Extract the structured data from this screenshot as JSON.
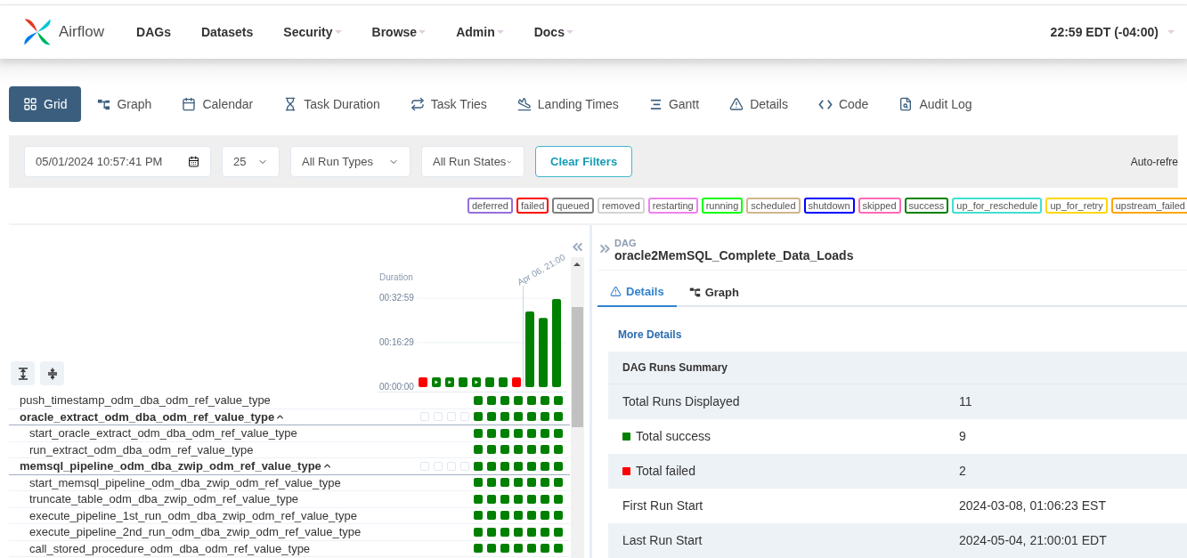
{
  "navbar": {
    "brand": "Airflow",
    "items": [
      {
        "label": "DAGs",
        "dropdown": false
      },
      {
        "label": "Datasets",
        "dropdown": false
      },
      {
        "label": "Security",
        "dropdown": true
      },
      {
        "label": "Browse",
        "dropdown": true
      },
      {
        "label": "Admin",
        "dropdown": true
      },
      {
        "label": "Docs",
        "dropdown": true
      }
    ],
    "clock": "22:59 EDT (-04:00)"
  },
  "view_tabs": [
    {
      "label": "Grid",
      "selected": true
    },
    {
      "label": "Graph",
      "selected": false
    },
    {
      "label": "Calendar",
      "selected": false
    },
    {
      "label": "Task Duration",
      "selected": false
    },
    {
      "label": "Task Tries",
      "selected": false
    },
    {
      "label": "Landing Times",
      "selected": false
    },
    {
      "label": "Gantt",
      "selected": false
    },
    {
      "label": "Details",
      "selected": false
    },
    {
      "label": "Code",
      "selected": false
    },
    {
      "label": "Audit Log",
      "selected": false
    }
  ],
  "filters": {
    "base_date": "05/01/2024 10:57:41 PM",
    "num_runs": "25",
    "run_type": "All Run Types",
    "run_state": "All Run States",
    "clear_button": "Clear Filters",
    "auto_refresh": "Auto-refre"
  },
  "legend": [
    {
      "label": "deferred",
      "color": "#9370db"
    },
    {
      "label": "failed",
      "color": "#ff0000"
    },
    {
      "label": "queued",
      "color": "#808080"
    },
    {
      "label": "removed",
      "color": "#d3d3d3"
    },
    {
      "label": "restarting",
      "color": "#ee82ee"
    },
    {
      "label": "running",
      "color": "#00ff00"
    },
    {
      "label": "scheduled",
      "color": "#d2b48c"
    },
    {
      "label": "shutdown",
      "color": "#0000ff"
    },
    {
      "label": "skipped",
      "color": "#ff69b4"
    },
    {
      "label": "success",
      "color": "#008000"
    },
    {
      "label": "up_for_reschedule",
      "color": "#40e0d0"
    },
    {
      "label": "up_for_retry",
      "color": "#ffd700"
    },
    {
      "label": "upstream_failed",
      "color": "#ffa500"
    }
  ],
  "grid": {
    "chart_data": {
      "type": "bar",
      "title": "Duration",
      "series": [
        {
          "values": [
            220,
            220,
            220,
            220,
            220,
            220,
            220,
            220,
            1680,
            1540,
            1960
          ]
        }
      ],
      "ylim": [
        0,
        1979
      ],
      "yticks": [
        {
          "value": 0,
          "label": "00:00:00"
        },
        {
          "value": 989,
          "label": "00:16:29"
        },
        {
          "value": 1979,
          "label": "00:32:59"
        }
      ],
      "annotations": [
        "Apr 06, 21:00"
      ]
    },
    "runs": [
      {
        "manual": false,
        "color": "#ff0000"
      },
      {
        "manual": true,
        "color": "#008000"
      },
      {
        "manual": true,
        "color": "#008000"
      },
      {
        "manual": false,
        "color": "#008000"
      },
      {
        "manual": true,
        "color": "#008000"
      },
      {
        "manual": false,
        "color": "#008000"
      },
      {
        "manual": false,
        "color": "#008000"
      },
      {
        "manual": false,
        "color": "#ff0000"
      },
      {
        "manual": false,
        "color": "#008000"
      },
      {
        "manual": false,
        "color": "#008000"
      },
      {
        "manual": false,
        "color": "#008000"
      }
    ],
    "tasks": [
      {
        "name": "push_timestamp_odm_dba_odm_ref_value_type",
        "instances": [
          {
            "kind": "none"
          },
          {
            "kind": "none"
          },
          {
            "kind": "none"
          },
          {
            "kind": "none"
          },
          {
            "kind": "success"
          },
          {
            "kind": "success"
          },
          {
            "kind": "success"
          },
          {
            "kind": "success"
          },
          {
            "kind": "success"
          },
          {
            "kind": "success"
          },
          {
            "kind": "success"
          }
        ]
      },
      {
        "name": "oracle_extract_odm_dba_odm_ref_value_type",
        "expanded": true,
        "instances": [
          {
            "kind": "empty"
          },
          {
            "kind": "empty"
          },
          {
            "kind": "empty"
          },
          {
            "kind": "empty"
          },
          {
            "kind": "success"
          },
          {
            "kind": "success"
          },
          {
            "kind": "success"
          },
          {
            "kind": "success"
          },
          {
            "kind": "success"
          },
          {
            "kind": "success"
          },
          {
            "kind": "success"
          }
        ],
        "children": [
          {
            "name": "start_oracle_extract_odm_dba_odm_ref_value_type",
            "instances": [
              {
                "kind": "none"
              },
              {
                "kind": "none"
              },
              {
                "kind": "none"
              },
              {
                "kind": "none"
              },
              {
                "kind": "success"
              },
              {
                "kind": "success"
              },
              {
                "kind": "success"
              },
              {
                "kind": "success"
              },
              {
                "kind": "success"
              },
              {
                "kind": "success"
              },
              {
                "kind": "success"
              }
            ]
          },
          {
            "name": "run_extract_odm_dba_odm_ref_value_type",
            "instances": [
              {
                "kind": "none"
              },
              {
                "kind": "none"
              },
              {
                "kind": "none"
              },
              {
                "kind": "none"
              },
              {
                "kind": "success"
              },
              {
                "kind": "success"
              },
              {
                "kind": "success"
              },
              {
                "kind": "success"
              },
              {
                "kind": "success"
              },
              {
                "kind": "success"
              },
              {
                "kind": "success"
              }
            ]
          }
        ]
      },
      {
        "name": "memsql_pipeline_odm_dba_zwip_odm_ref_value_type",
        "expanded": true,
        "instances": [
          {
            "kind": "empty"
          },
          {
            "kind": "empty"
          },
          {
            "kind": "empty"
          },
          {
            "kind": "empty"
          },
          {
            "kind": "success"
          },
          {
            "kind": "success"
          },
          {
            "kind": "success"
          },
          {
            "kind": "success"
          },
          {
            "kind": "success"
          },
          {
            "kind": "success"
          },
          {
            "kind": "success"
          }
        ],
        "children": [
          {
            "name": "start_memsql_pipeline_odm_dba_zwip_odm_ref_value_type",
            "instances": [
              {
                "kind": "none"
              },
              {
                "kind": "none"
              },
              {
                "kind": "none"
              },
              {
                "kind": "none"
              },
              {
                "kind": "success"
              },
              {
                "kind": "success"
              },
              {
                "kind": "success"
              },
              {
                "kind": "success"
              },
              {
                "kind": "success"
              },
              {
                "kind": "success"
              },
              {
                "kind": "success"
              }
            ]
          },
          {
            "name": "truncate_table_odm_dba_zwip_odm_ref_value_type",
            "instances": [
              {
                "kind": "none"
              },
              {
                "kind": "none"
              },
              {
                "kind": "none"
              },
              {
                "kind": "none"
              },
              {
                "kind": "success"
              },
              {
                "kind": "success"
              },
              {
                "kind": "success"
              },
              {
                "kind": "success"
              },
              {
                "kind": "success"
              },
              {
                "kind": "success"
              },
              {
                "kind": "success"
              }
            ]
          },
          {
            "name": "execute_pipeline_1st_run_odm_dba_zwip_odm_ref_value_type",
            "instances": [
              {
                "kind": "none"
              },
              {
                "kind": "none"
              },
              {
                "kind": "none"
              },
              {
                "kind": "none"
              },
              {
                "kind": "success"
              },
              {
                "kind": "success"
              },
              {
                "kind": "success"
              },
              {
                "kind": "success"
              },
              {
                "kind": "success"
              },
              {
                "kind": "success"
              },
              {
                "kind": "success"
              }
            ]
          },
          {
            "name": "execute_pipeline_2nd_run_odm_dba_zwip_odm_ref_value_type",
            "instances": [
              {
                "kind": "none"
              },
              {
                "kind": "none"
              },
              {
                "kind": "none"
              },
              {
                "kind": "none"
              },
              {
                "kind": "success"
              },
              {
                "kind": "success"
              },
              {
                "kind": "success"
              },
              {
                "kind": "success"
              },
              {
                "kind": "success"
              },
              {
                "kind": "success"
              },
              {
                "kind": "success"
              }
            ]
          },
          {
            "name": "call_stored_procedure_odm_dba_odm_ref_value_type",
            "instances": [
              {
                "kind": "none"
              },
              {
                "kind": "none"
              },
              {
                "kind": "none"
              },
              {
                "kind": "none"
              },
              {
                "kind": "success"
              },
              {
                "kind": "success"
              },
              {
                "kind": "success"
              },
              {
                "kind": "success"
              },
              {
                "kind": "success"
              },
              {
                "kind": "success"
              },
              {
                "kind": "success"
              }
            ]
          }
        ]
      }
    ]
  },
  "details": {
    "kicker": "DAG",
    "title": "oracle2MemSQL_Complete_Data_Loads",
    "tabs": [
      {
        "label": "Details",
        "selected": true
      },
      {
        "label": "Graph",
        "selected": false
      }
    ],
    "link": "More Details",
    "summary_title": "DAG Runs Summary",
    "rows": [
      {
        "label": "Total Runs Displayed",
        "value": "11"
      },
      {
        "label": "Total success",
        "value": "9",
        "color": "#008000"
      },
      {
        "label": "Total failed",
        "value": "2",
        "color": "#ff0000"
      },
      {
        "label": "First Run Start",
        "value": "2024-03-08, 01:06:23 EST"
      },
      {
        "label": "Last Run Start",
        "value": "2024-05-04, 21:00:01 EDT"
      }
    ]
  }
}
